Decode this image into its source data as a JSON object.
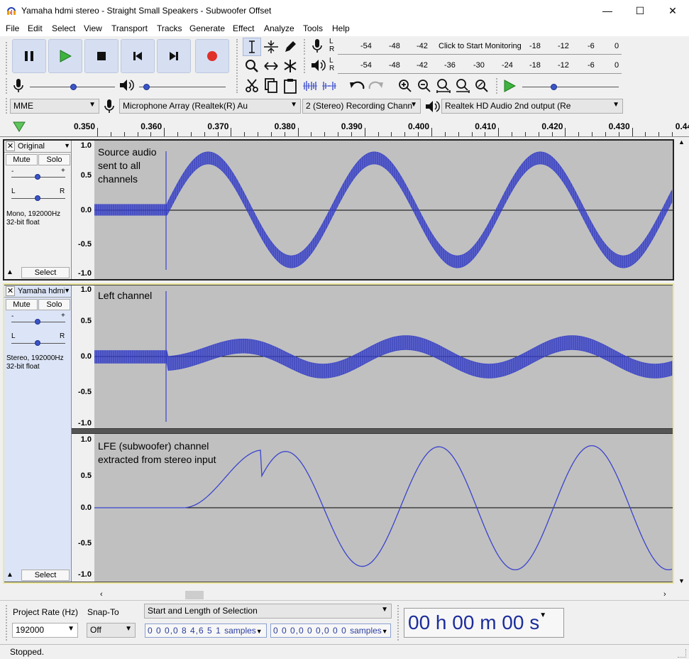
{
  "window": {
    "title": "Yamaha hdmi stereo - Straight Small Speakers - Subwoofer Offset",
    "minimize": "—",
    "maximize": "☐",
    "close": "✕"
  },
  "menu": [
    "File",
    "Edit",
    "Select",
    "View",
    "Transport",
    "Tracks",
    "Generate",
    "Effect",
    "Analyze",
    "Tools",
    "Help"
  ],
  "transport": {
    "pause_icon": "pause-icon",
    "play_icon": "play-icon",
    "stop_icon": "stop-icon",
    "skip_start_icon": "skip-to-start-icon",
    "skip_end_icon": "skip-to-end-icon",
    "record_icon": "record-icon"
  },
  "meters": {
    "record_ticks": [
      "-54",
      "-48",
      "-42",
      "Click to Start Monitoring",
      "-18",
      "-12",
      "-6",
      "0"
    ],
    "playback_ticks": [
      "-54",
      "-48",
      "-42",
      "-36",
      "-30",
      "-24",
      "-18",
      "-12",
      "-6",
      "0"
    ],
    "L": "L",
    "R": "R"
  },
  "mixer": {
    "record_volume": 0.52,
    "playback_volume": 0.05,
    "play_at_speed": 0.32
  },
  "devices": {
    "host": "MME",
    "input": "Microphone Array (Realtek(R) Au",
    "channels": "2 (Stereo) Recording Chann",
    "output": "Realtek HD Audio 2nd output (Re"
  },
  "ruler": {
    "ticks": [
      "0.350",
      "0.360",
      "0.370",
      "0.380",
      "0.390",
      "0.400",
      "0.410",
      "0.420",
      "0.430",
      "0.440"
    ]
  },
  "tracks": [
    {
      "name": "Original",
      "mute": "Mute",
      "solo": "Solo",
      "gain_minus": "-",
      "gain_plus": "+",
      "pan_left": "L",
      "pan_right": "R",
      "info_line1": "Mono, 192000Hz",
      "info_line2": "32-bit float",
      "select": "Select",
      "scale": [
        "1.0",
        "0.5",
        "0.0",
        "-0.5",
        "-1.0"
      ],
      "label": [
        "Source audio",
        "sent to all",
        "channels"
      ]
    },
    {
      "name": "Yamaha hdmi",
      "mute": "Mute",
      "solo": "Solo",
      "gain_minus": "-",
      "gain_plus": "+",
      "pan_left": "L",
      "pan_right": "R",
      "info_line1": "Stereo, 192000Hz",
      "info_line2": "32-bit float",
      "select": "Select",
      "scale_left": [
        "1.0",
        "0.5",
        "0.0",
        "-0.5",
        "-1.0"
      ],
      "scale_right": [
        "1.0",
        "0.5",
        "0.0",
        "-0.5",
        "-1.0"
      ],
      "label_left": [
        "Left channel"
      ],
      "label_right": [
        "LFE (subwoofer) channel",
        "extracted from stereo input"
      ]
    }
  ],
  "selection_toolbar": {
    "project_rate_label": "Project Rate (Hz)",
    "project_rate": "192000",
    "snap_label": "Snap-To",
    "snap_value": "Off",
    "selection_mode": "Start and Length of Selection",
    "start": "0 0 0,0 8 4,6 5 1",
    "start_unit": "samples",
    "length": "0 0 0,0 0 0,0 0 0",
    "length_unit": "samples",
    "time": "00 h 00 m 00 s"
  },
  "status": "Stopped.",
  "colors": {
    "waveform": "#3b44cc",
    "track_bg": "#c0c0c0",
    "selected_border": "#ece79c",
    "accent": "#3a55c8"
  }
}
